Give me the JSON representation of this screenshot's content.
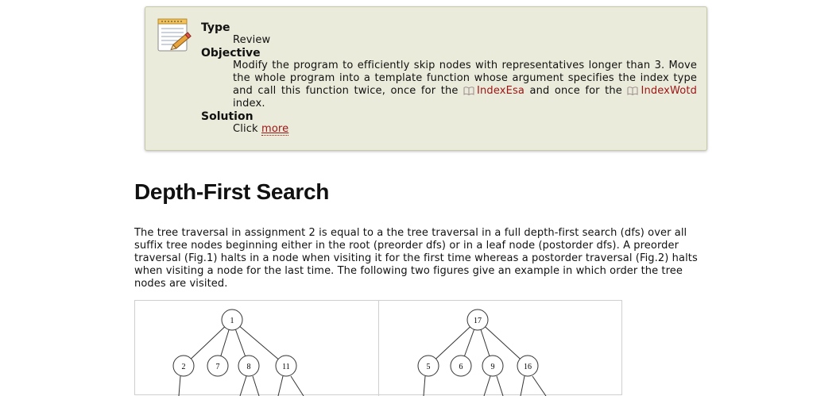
{
  "assignment": {
    "icon": "notepad-pencil-icon",
    "type_label": "Type",
    "type_value": "Review",
    "objective_label": "Objective",
    "objective_text_1": "Modify the program to efficiently skip nodes with representatives longer than 3. Move the whole program into a template function whose argument specifies the index type and call this function twice, once for the ",
    "link_index_esa": "IndexEsa",
    "objective_text_2": " and once for the ",
    "link_index_wotd": "IndexWotd",
    "objective_text_3": " index.",
    "solution_label": "Solution",
    "solution_prefix": "Click ",
    "solution_link": "more"
  },
  "section": {
    "title": "Depth-First Search",
    "paragraph": "The tree traversal in assignment 2 is equal to a the tree traversal in a full depth-first search (dfs) over all suffix tree nodes beginning either in the root (preorder dfs) or in a leaf node (postorder dfs). A preorder traversal (Fig.1) halts in a node when visiting it for the first time whereas a postorder traversal (Fig.2) halts when visiting a node for the last time. The following two figures give an example in which order the tree nodes are visited."
  },
  "figures": {
    "preorder": {
      "root": "1",
      "children": [
        "2",
        "7",
        "8",
        "11"
      ]
    },
    "postorder": {
      "root": "17",
      "children": [
        "5",
        "6",
        "9",
        "16"
      ]
    }
  },
  "colors": {
    "box_bg": "#ebebdb",
    "link": "#9b1414"
  }
}
